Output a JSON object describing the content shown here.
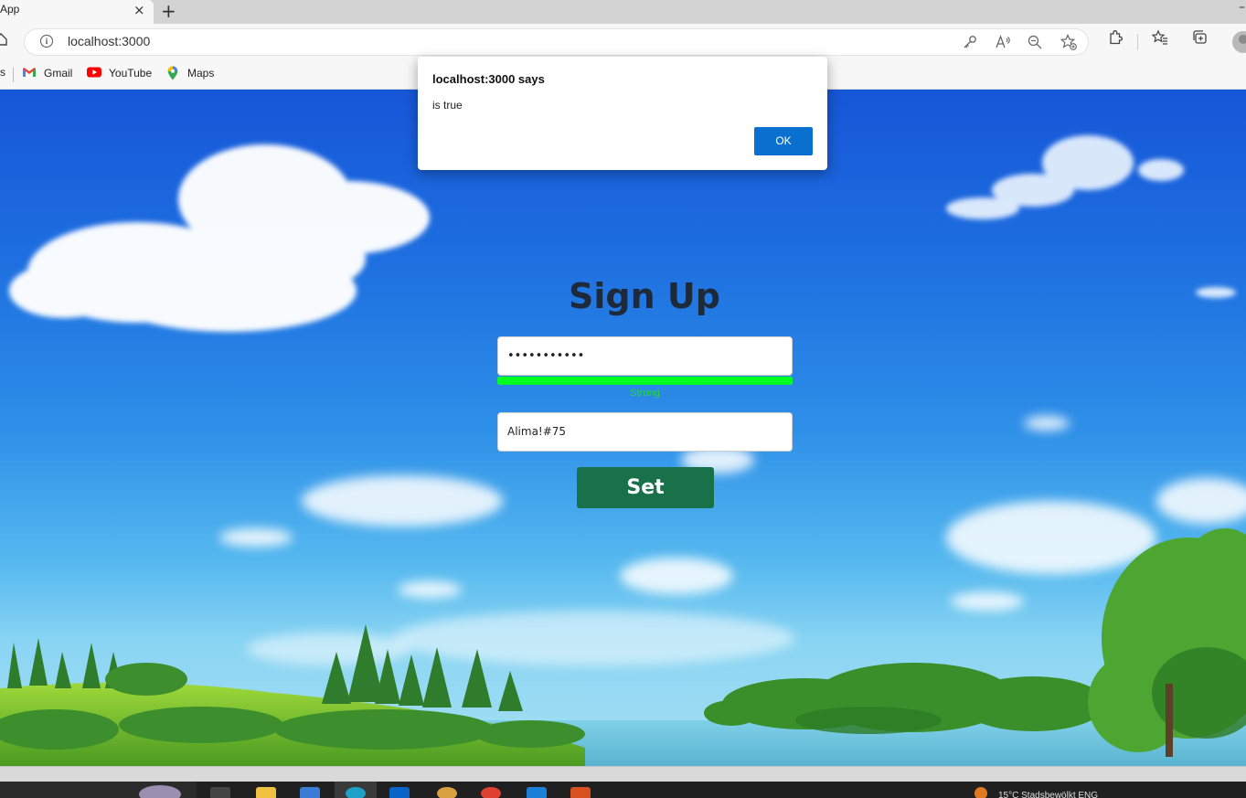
{
  "browser": {
    "tab_title": "App",
    "tab_close": "×",
    "new_tab": "+",
    "url": "localhost:3000",
    "bookmarks": [
      {
        "label": "Gmail",
        "icon": "gmail-icon"
      },
      {
        "label": "YouTube",
        "icon": "youtube-icon"
      },
      {
        "label": "Maps",
        "icon": "maps-icon"
      }
    ]
  },
  "alert": {
    "title": "localhost:3000 says",
    "message": "is true",
    "ok_label": "OK"
  },
  "form": {
    "title": "Sign Up",
    "password_masked": "•••••••••••",
    "strength_label": "Strong",
    "strength_level": 1.0,
    "confirm_value": "Alima!#75",
    "set_label": "Set"
  },
  "taskbar": {
    "tray_text": "15°C  Stadsbewölkt  ENG"
  },
  "colors": {
    "set_button": "#187148",
    "strength_fill": "#00ff21",
    "alert_ok": "#0a70d0",
    "heading": "#1e2a3a"
  }
}
